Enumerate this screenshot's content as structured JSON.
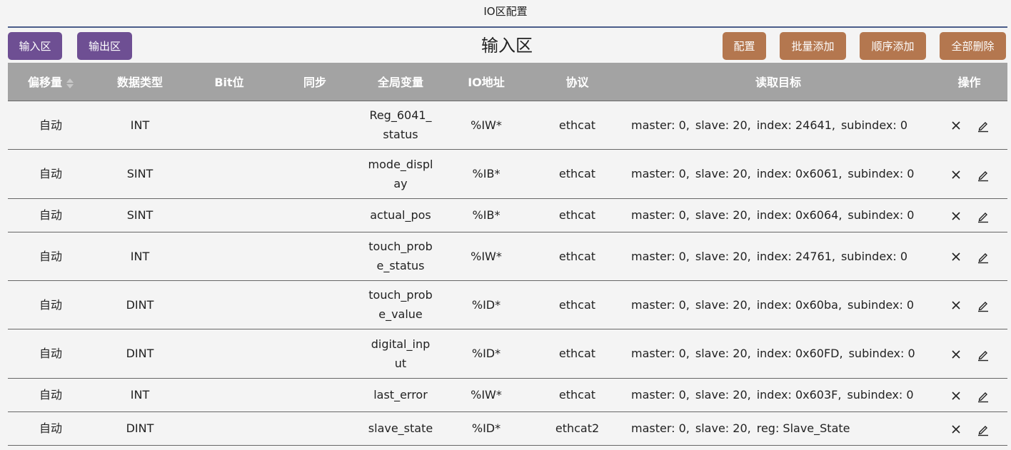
{
  "window": {
    "title": "IO区配置"
  },
  "toolbar": {
    "input_tab": "输入区",
    "output_tab": "输出区",
    "section_title": "输入区",
    "config": "配置",
    "batch_add": "批量添加",
    "seq_add": "顺序添加",
    "delete_all": "全部删除"
  },
  "colors": {
    "tab_button": "#6e4f93",
    "action_button": "#b4774f",
    "header_bg": "#a3a3a3",
    "title_rule": "#4a5d8a"
  },
  "table": {
    "columns": [
      "偏移量",
      "数据类型",
      "Bit位",
      "同步",
      "全局变量",
      "IO地址",
      "协议",
      "读取目标",
      "操作"
    ],
    "sort_icon": "sort-icon",
    "rows": [
      {
        "offset": "自动",
        "type": "INT",
        "bit": "",
        "sync": "",
        "var": "Reg_6041_status",
        "io": "%IW*",
        "proto": "ethcat",
        "target": [
          "master: 0,",
          "slave: 20,",
          "index: 24641,",
          "subindex: 0"
        ]
      },
      {
        "offset": "自动",
        "type": "SINT",
        "bit": "",
        "sync": "",
        "var": "mode_display",
        "io": "%IB*",
        "proto": "ethcat",
        "target": [
          "master: 0,",
          "slave: 20,",
          "index: 0x6061,",
          "subindex: 0"
        ]
      },
      {
        "offset": "自动",
        "type": "SINT",
        "bit": "",
        "sync": "",
        "var": "actual_pos",
        "io": "%IB*",
        "proto": "ethcat",
        "target": [
          "master: 0,",
          "slave: 20,",
          "index: 0x6064,",
          "subindex: 0"
        ]
      },
      {
        "offset": "自动",
        "type": "INT",
        "bit": "",
        "sync": "",
        "var": "touch_probe_status",
        "io": "%IW*",
        "proto": "ethcat",
        "target": [
          "master: 0,",
          "slave: 20,",
          "index: 24761,",
          "subindex: 0"
        ]
      },
      {
        "offset": "自动",
        "type": "DINT",
        "bit": "",
        "sync": "",
        "var": "touch_probe_value",
        "io": "%ID*",
        "proto": "ethcat",
        "target": [
          "master: 0,",
          "slave: 20,",
          "index: 0x60ba,",
          "subindex: 0"
        ]
      },
      {
        "offset": "自动",
        "type": "DINT",
        "bit": "",
        "sync": "",
        "var": "digital_input",
        "io": "%ID*",
        "proto": "ethcat",
        "target": [
          "master: 0,",
          "slave: 20,",
          "index: 0x60FD,",
          "subindex: 0"
        ]
      },
      {
        "offset": "自动",
        "type": "INT",
        "bit": "",
        "sync": "",
        "var": "last_error",
        "io": "%IW*",
        "proto": "ethcat",
        "target": [
          "master: 0,",
          "slave: 20,",
          "index: 0x603F,",
          "subindex: 0"
        ]
      },
      {
        "offset": "自动",
        "type": "DINT",
        "bit": "",
        "sync": "",
        "var": "slave_state",
        "io": "%ID*",
        "proto": "ethcat2",
        "target": [
          "master: 0,",
          "slave: 20,",
          "reg: Slave_State"
        ]
      }
    ],
    "row_actions": [
      "close-icon",
      "edit-icon"
    ]
  }
}
